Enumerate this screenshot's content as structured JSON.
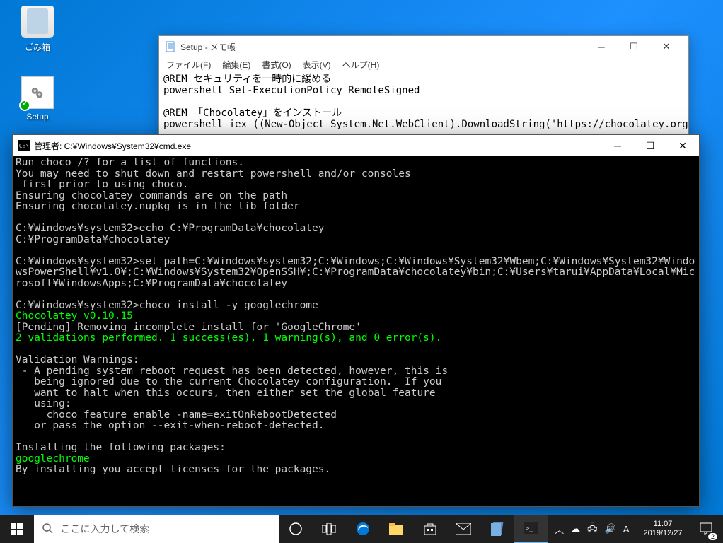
{
  "desktop": {
    "recycle_bin_label": "ごみ箱",
    "setup_label": "Setup"
  },
  "notepad": {
    "title": "Setup - メモ帳",
    "menu": {
      "file": "ファイル(F)",
      "edit": "編集(E)",
      "format": "書式(O)",
      "view": "表示(V)",
      "help": "ヘルプ(H)"
    },
    "content": "@REM セキュリティを一時的に緩める\npowershell Set-ExecutionPolicy RemoteSigned\n\n@REM 「Chocolatey」をインストール\npowershell iex ((New-Object System.Net.WebClient).DownloadString('https://chocolatey.org/in"
  },
  "cmd": {
    "title": "管理者: C:¥Windows¥System32¥cmd.exe",
    "lines": [
      {
        "t": "Run choco /? for a list of functions.",
        "c": ""
      },
      {
        "t": "You may need to shut down and restart powershell and/or consoles",
        "c": ""
      },
      {
        "t": " first prior to using choco.",
        "c": ""
      },
      {
        "t": "Ensuring chocolatey commands are on the path",
        "c": ""
      },
      {
        "t": "Ensuring chocolatey.nupkg is in the lib folder",
        "c": ""
      },
      {
        "t": "",
        "c": ""
      },
      {
        "t": "C:¥Windows¥system32>echo C:¥ProgramData¥chocolatey",
        "c": ""
      },
      {
        "t": "C:¥ProgramData¥chocolatey",
        "c": ""
      },
      {
        "t": "",
        "c": ""
      },
      {
        "t": "C:¥Windows¥system32>set path=C:¥Windows¥system32;C:¥Windows;C:¥Windows¥System32¥Wbem;C:¥Windows¥System32¥WindowsPowerShell¥v1.0¥;C:¥Windows¥System32¥OpenSSH¥;C:¥ProgramData¥chocolatey¥bin;C:¥Users¥tarui¥AppData¥Local¥Microsoft¥WindowsApps;C:¥ProgramData¥chocolatey",
        "c": ""
      },
      {
        "t": "",
        "c": ""
      },
      {
        "t": "C:¥Windows¥system32>choco install -y googlechrome",
        "c": ""
      },
      {
        "t": "Chocolatey v0.10.15",
        "c": "g"
      },
      {
        "t": "[Pending] Removing incomplete install for 'GoogleChrome'",
        "c": ""
      },
      {
        "t": "2 validations performed. 1 success(es), 1 warning(s), and 0 error(s).",
        "c": "g"
      },
      {
        "t": "",
        "c": ""
      },
      {
        "t": "Validation Warnings:",
        "c": ""
      },
      {
        "t": " - A pending system reboot request has been detected, however, this is",
        "c": ""
      },
      {
        "t": "   being ignored due to the current Chocolatey configuration.  If you",
        "c": ""
      },
      {
        "t": "   want to halt when this occurs, then either set the global feature",
        "c": ""
      },
      {
        "t": "   using:",
        "c": ""
      },
      {
        "t": "     choco feature enable -name=exitOnRebootDetected",
        "c": ""
      },
      {
        "t": "   or pass the option --exit-when-reboot-detected.",
        "c": ""
      },
      {
        "t": "",
        "c": ""
      },
      {
        "t": "Installing the following packages:",
        "c": ""
      },
      {
        "t": "googlechrome",
        "c": "g"
      },
      {
        "t": "By installing you accept licenses for the packages.",
        "c": ""
      }
    ]
  },
  "taskbar": {
    "search_placeholder": "ここに入力して検索",
    "time": "11:07",
    "date": "2019/12/27",
    "ime": "A",
    "notif_count": "2"
  }
}
